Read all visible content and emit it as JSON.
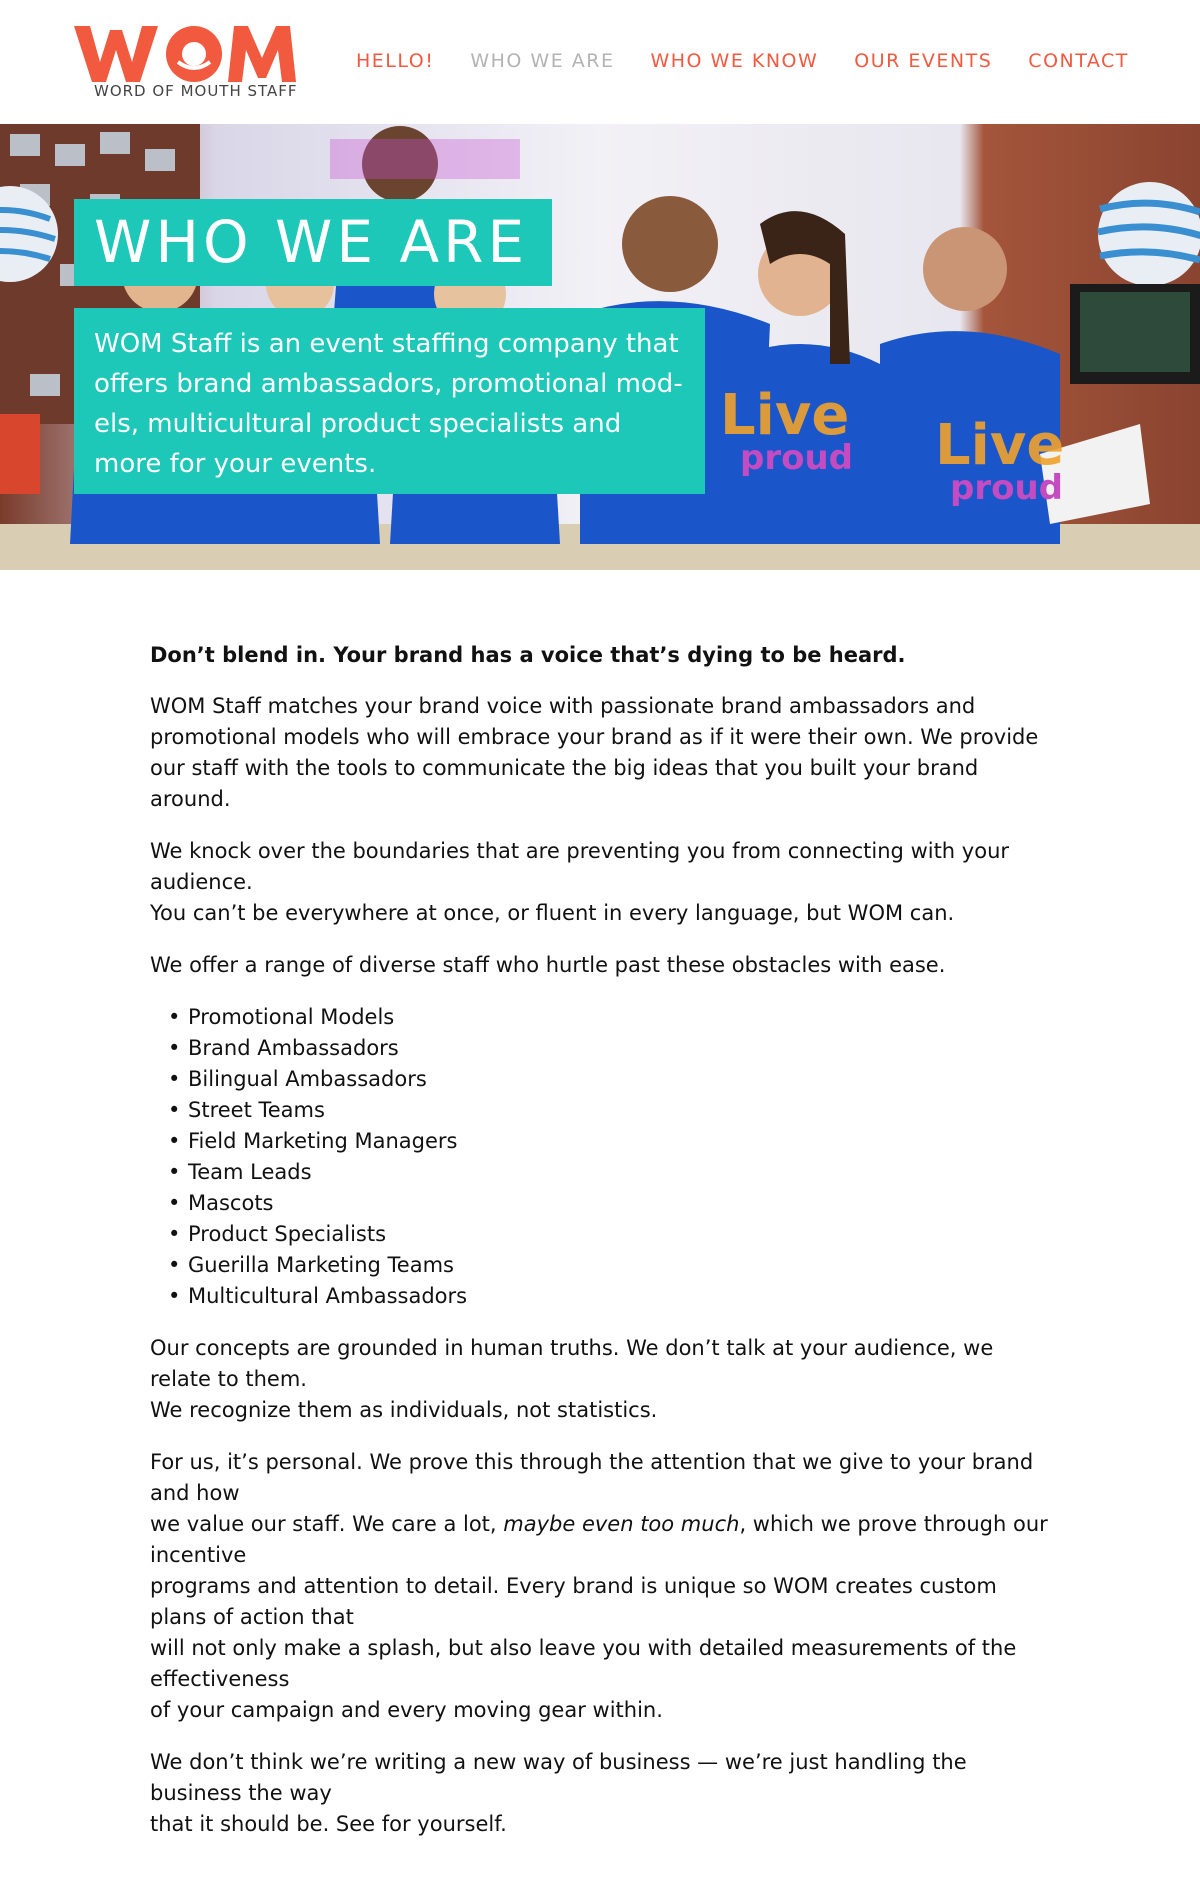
{
  "brand": {
    "logo_text": "WOM",
    "tagline": "WORD OF MOUTH STAFF",
    "accent_color": "#f25a3f",
    "teal_color": "#1ec8b8"
  },
  "nav": {
    "items": [
      {
        "label": "HELLO!",
        "active": false
      },
      {
        "label": "WHO WE ARE",
        "active": true
      },
      {
        "label": "WHO WE KNOW",
        "active": false
      },
      {
        "label": "OUR EVENTS",
        "active": false
      },
      {
        "label": "CONTACT",
        "active": false
      }
    ]
  },
  "hero": {
    "title": "WHO WE ARE",
    "text": "WOM Staff is an event staffing company that offers brand ambassadors, promotional mod-els, multicultural product specialists and more for your events."
  },
  "content": {
    "lead": "Don’t blend in.  Your brand has a voice that’s dying to be heard.",
    "p1": "WOM Staff matches your brand voice with passionate brand ambassadors and promotional models who will embrace your brand as if it were their own. We provide our staff with the tools to communicate the big ideas that you built your brand around.",
    "p2a": "We knock over the boundaries that are preventing you from connecting with your audience.",
    "p2b": "You can’t be everywhere at once, or fluent in every language, but WOM can.",
    "p3": "We offer a range of diverse staff who hurtle past these obstacles with ease.",
    "list": [
      "Promotional Models",
      "Brand Ambassadors",
      "Bilingual Ambassadors",
      "Street Teams",
      "Field Marketing Managers",
      "Team Leads",
      "Mascots",
      "Product Specialists",
      "Guerilla Marketing Teams",
      "Multicultural Ambassadors"
    ],
    "p4a": "Our concepts are grounded in human truths. We don’t talk at your audience, we relate to them.",
    "p4b": "We recognize them as individuals, not statistics.",
    "p5_1": "For us, it’s personal. We prove this through the attention that we give to your brand and how",
    "p5_2a": "we value our staff. We care a lot, ",
    "p5_2em": "maybe even too much",
    "p5_2b": ", which we prove through our incentive",
    "p5_3": "programs and attention to detail. Every brand is unique  so WOM creates custom plans of action that",
    "p5_4": "will not only make a splash, but also leave you with detailed measurements of the effectiveness",
    "p5_5": "of your campaign and every moving gear within.",
    "p6a": "We don’t think we’re writing a new way of business — we’re  just handling the business the way",
    "p6b": "that it should be. See for yourself."
  }
}
